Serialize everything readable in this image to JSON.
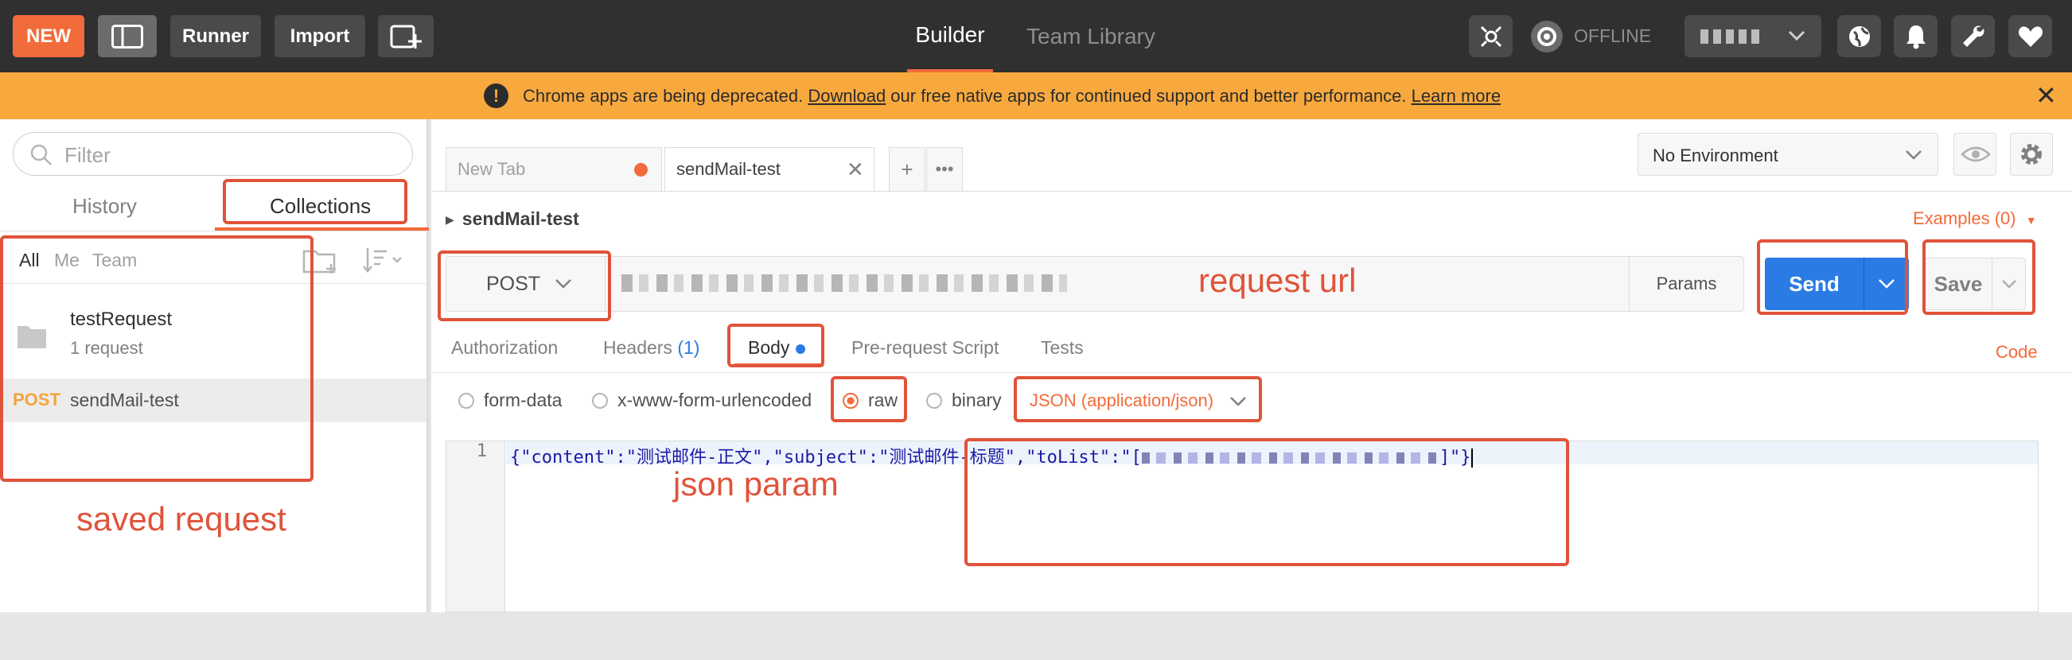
{
  "topbar": {
    "new_label": "NEW",
    "runner_label": "Runner",
    "import_label": "Import",
    "builder_tab": "Builder",
    "team_library_tab": "Team Library",
    "sync_status": "OFFLINE"
  },
  "banner": {
    "text_before": "Chrome apps are being deprecated. ",
    "download_link": "Download",
    "text_after": " our free native apps for continued support and better performance. ",
    "learn_more_link": "Learn more",
    "close": "✕"
  },
  "sidebar": {
    "filter_placeholder": "Filter",
    "tabs": [
      "History",
      "Collections"
    ],
    "filters": [
      "All",
      "Me",
      "Team"
    ],
    "collection": {
      "name": "testRequest",
      "count": "1 request"
    },
    "request": {
      "method": "POST",
      "name": "sendMail-test"
    }
  },
  "main": {
    "tabs": [
      {
        "label": "New Tab"
      },
      {
        "label": "sendMail-test"
      }
    ],
    "add_tab": "+",
    "more_tabs": "•••",
    "environment": "No Environment",
    "breadcrumb": "sendMail-test",
    "examples": "Examples (0)",
    "method": "POST",
    "params": "Params",
    "send": "Send",
    "save": "Save",
    "subtabs": {
      "authorization": "Authorization",
      "headers": "Headers",
      "headers_count": "(1)",
      "body": "Body",
      "pre_request": "Pre-request Script",
      "tests": "Tests"
    },
    "code_link": "Code",
    "body_types": [
      "form-data",
      "x-www-form-urlencoded",
      "raw",
      "binary"
    ],
    "content_type": "JSON (application/json)",
    "editor": {
      "line_number": "1",
      "code_start": "{\"content\":\"测试邮件-正文\",\"subject\":\"测试邮件-标题\",\"toList\":\"[",
      "code_end": "]\"}"
    }
  },
  "annotations": {
    "request_url": "request url",
    "json_param": "json param",
    "saved_request": "saved request"
  },
  "colors": {
    "accent": "#f26b3a",
    "send_blue": "#2a7be4",
    "banner": "#f8a93e",
    "annotation_red": "#e0533a",
    "topbar": "#303030"
  }
}
